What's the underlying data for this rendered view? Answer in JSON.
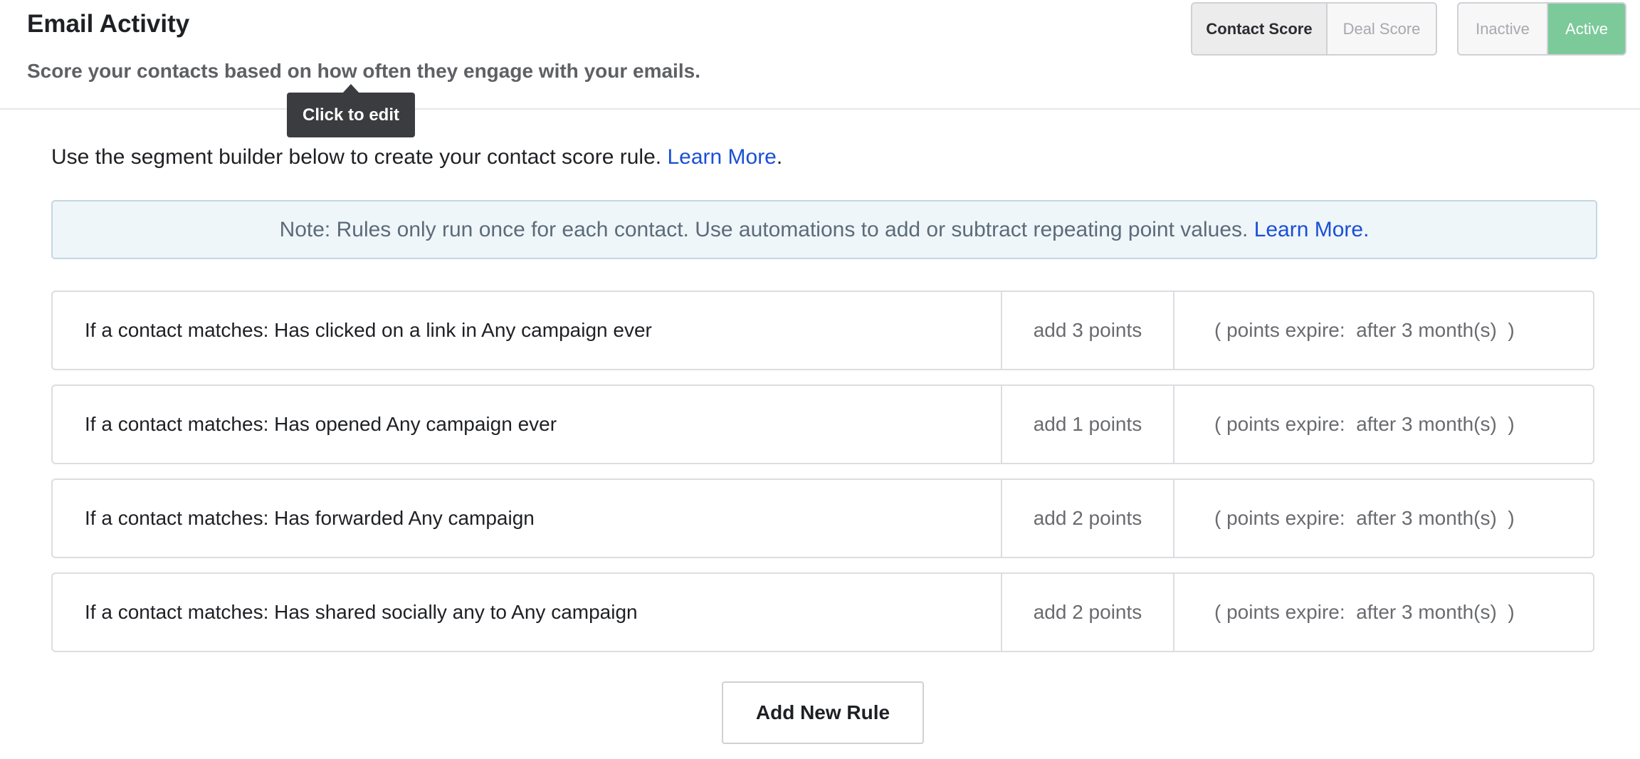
{
  "header": {
    "title": "Email Activity",
    "subtitle": "Score your contacts based on how often they engage with your emails."
  },
  "score_toggle": {
    "options": [
      "Contact Score",
      "Deal Score"
    ],
    "selected": "Contact Score"
  },
  "status_toggle": {
    "options": [
      "Inactive",
      "Active"
    ],
    "selected": "Active",
    "active_color": "#7cc99a"
  },
  "tooltip": {
    "text": "Click to edit"
  },
  "intro": {
    "text": "Use the segment builder below to create your contact score rule.",
    "link": "Learn More",
    "suffix": "."
  },
  "note": {
    "text": "Note: Rules only run once for each contact. Use automations to add or subtract repeating point values.",
    "link": "Learn More."
  },
  "rules": [
    {
      "condition": "If a contact matches: Has clicked on a link in Any campaign ever",
      "points": "add 3 points",
      "expire": "( points expire:  after 3 month(s)  )"
    },
    {
      "condition": "If a contact matches: Has opened Any campaign ever",
      "points": "add 1 points",
      "expire": "( points expire:  after 3 month(s)  )"
    },
    {
      "condition": "If a contact matches:  Has forwarded Any campaign",
      "points": "add 2 points",
      "expire": "( points expire:  after 3 month(s)  )"
    },
    {
      "condition": "If a contact matches: Has shared socially any to Any campaign",
      "points": "add 2 points",
      "expire": "( points expire:  after 3 month(s)  )"
    }
  ],
  "add_rule_label": "Add New Rule",
  "colors": {
    "link": "#1a4fd6",
    "note_bg": "#eff6fa"
  }
}
